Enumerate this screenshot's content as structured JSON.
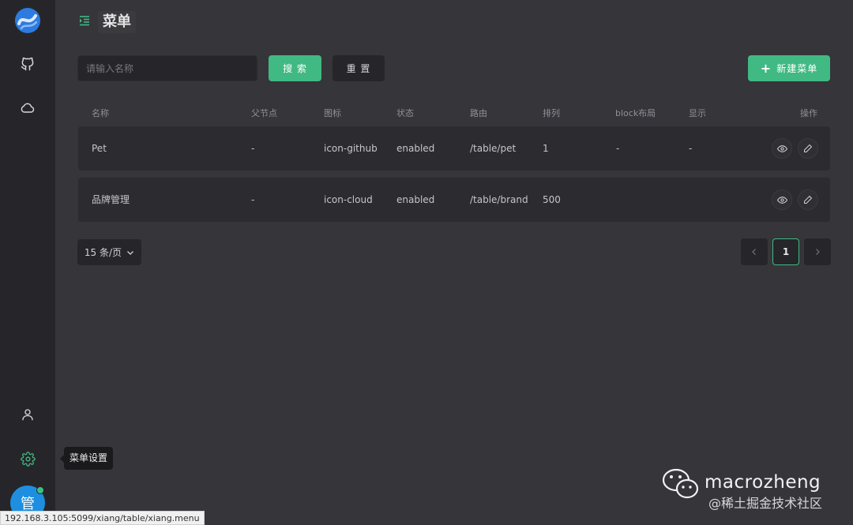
{
  "sidebar": {
    "logo_icon": "app-logo",
    "items": [
      {
        "icon": "github-icon"
      },
      {
        "icon": "cloud-icon"
      }
    ],
    "bottom_items": [
      {
        "icon": "user-icon"
      },
      {
        "icon": "gear-icon",
        "active": true
      }
    ],
    "avatar_text": "管",
    "tooltip": "菜单设置"
  },
  "header": {
    "title": "菜单",
    "menu_icon": "indent-icon"
  },
  "toolbar": {
    "search_placeholder": "请输入名称",
    "search_value": "",
    "search_label": "搜 索",
    "reset_label": "重 置",
    "new_label": "新建菜单"
  },
  "table": {
    "columns": [
      "名称",
      "父节点",
      "图标",
      "状态",
      "路由",
      "排列",
      "block布局",
      "显示",
      "操作"
    ],
    "rows": [
      {
        "name": "Pet",
        "parent": "-",
        "icon": "icon-github",
        "status": "enabled",
        "route": "/table/pet",
        "order": "1",
        "block": "-",
        "show": "-"
      },
      {
        "name": "品牌管理",
        "parent": "-",
        "icon": "icon-cloud",
        "status": "enabled",
        "route": "/table/brand",
        "order": "500",
        "block": "",
        "show": ""
      }
    ]
  },
  "pagination": {
    "page_size_label": "15 条/页",
    "current_page": "1"
  },
  "status_bar_url": "192.168.3.105:5099/xiang/table/xiang.menu",
  "watermark": {
    "name": "macrozheng",
    "sub": "@稀土掘金技术社区"
  },
  "colors": {
    "accent": "#41b983",
    "background": "#35353a",
    "sidebar": "#26262a",
    "row": "#2b2b30"
  }
}
